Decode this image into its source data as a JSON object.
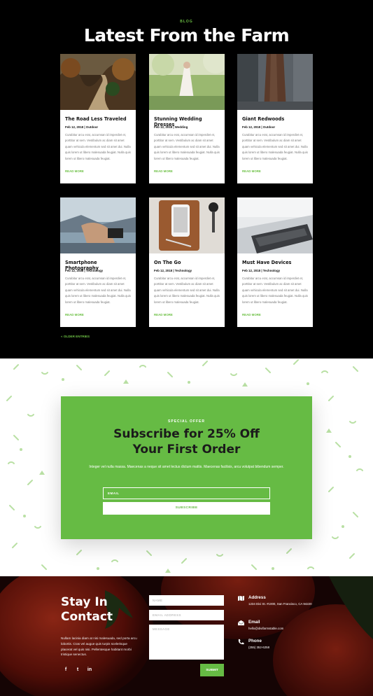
{
  "blog": {
    "kicker": "BLOG",
    "title": "Latest From the Farm",
    "excerpt": "Curabitur arcu erat, accumsan id imperdiet et, porttitor at sem. Vestibulum ac diam sit amet quam vehicula elementum sed sit amet dui. Nulla quis lorem ut libero malesuada feugiat. Nulla quis lorem ut libero malesuada feugiat.",
    "read_more": "READ MORE",
    "posts": [
      {
        "title": "The Road Less Traveled",
        "date": "Feb 12, 2018",
        "category": "Outdoor"
      },
      {
        "title": "Stunning Wedding Dresses",
        "date": "Feb 12, 2018",
        "category": "Wedding"
      },
      {
        "title": "Giant Redwoods",
        "date": "Feb 12, 2018",
        "category": "Outdoor"
      },
      {
        "title": "Smartphone Photography",
        "date": "Feb 12, 2018",
        "category": "Technology"
      },
      {
        "title": "On The Go",
        "date": "Feb 12, 2018",
        "category": "Technology"
      },
      {
        "title": "Must Have Devices",
        "date": "Feb 12, 2018",
        "category": "Technology"
      }
    ],
    "older_entries": "« OLDER ENTRIES"
  },
  "subscribe": {
    "kicker": "SPECIAL OFFER",
    "title_line1": "Subscribe for 25% Off",
    "title_line2": "Your First Order",
    "text": "Integer vel nulla massa. Maecenas a neque sit amet lectus dictum mattis. Maecenas facilisis, arcu volutpat bibendum semper.",
    "email_placeholder": "EMAIL",
    "button": "SUBSCRIBE"
  },
  "contact": {
    "title_line1": "Stay In",
    "title_line2": "Contact",
    "description": "Nullam lacinia diam at nisi malesuada, sed porta arcu lobortis. Cras vel augue quis turpis scelerisque placerat vel quis nisi. Pellentesque habitant morbi tristique senectus.",
    "social": [
      "f",
      "t",
      "in"
    ],
    "name_placeholder": "NAME",
    "email_placeholder": "EMAIL ADDRESS",
    "message_placeholder": "MESSAGE",
    "submit": "SUBMIT",
    "address_label": "Address",
    "address_value": "1234 Divi St. #1000, San Francisco, CA 94220",
    "email_label": "Email",
    "email_value": "hello@divifarmstable.com",
    "phone_label": "Phone",
    "phone_value": "(255) 352-6258"
  },
  "colors": {
    "accent": "#66bb44",
    "dark": "#000000"
  }
}
